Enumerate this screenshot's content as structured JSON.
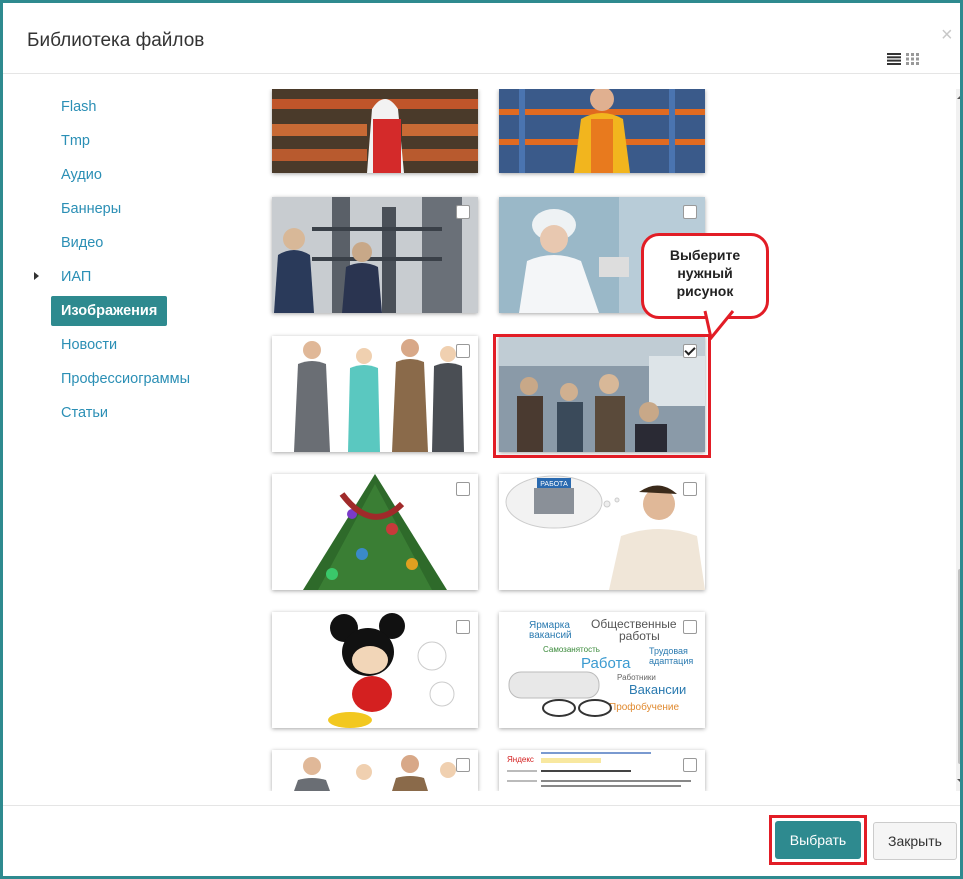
{
  "dialog": {
    "title": "Библиотека файлов",
    "close_symbol": "×"
  },
  "sidebar": {
    "items": [
      {
        "label": "Flash"
      },
      {
        "label": "Tmp"
      },
      {
        "label": "Аудио"
      },
      {
        "label": "Баннеры"
      },
      {
        "label": "Видео"
      },
      {
        "label": "ИАП",
        "expandable": true
      },
      {
        "label": "Изображения",
        "active": true
      },
      {
        "label": "Новости"
      },
      {
        "label": "Профессиограммы"
      },
      {
        "label": "Статьи"
      }
    ]
  },
  "gallery": {
    "thumbnails": [
      {
        "subject": "bakery-worker",
        "checked": false
      },
      {
        "subject": "warehouse-worker",
        "checked": false
      },
      {
        "subject": "industrial-workers",
        "checked": false
      },
      {
        "subject": "lab-worker",
        "checked": false
      },
      {
        "subject": "professionals-group",
        "checked": false
      },
      {
        "subject": "job-center-crowd",
        "checked": true
      },
      {
        "subject": "christmas-tree",
        "checked": false
      },
      {
        "subject": "thinking-man",
        "checked": false
      },
      {
        "subject": "cartoon-mouse",
        "checked": false
      },
      {
        "subject": "word-cloud",
        "checked": false
      },
      {
        "subject": "professionals-group-2",
        "checked": false
      },
      {
        "subject": "search-results-screenshot",
        "checked": false
      }
    ],
    "thumb_text": {
      "maze_sign": "РАБОТА",
      "wordcloud": [
        "Ярмарка",
        "вакансий",
        "Общественные",
        "работы",
        "Самозанятость",
        "Трудовая",
        "адаптация",
        "Работа",
        "Работники",
        "Вакансии",
        "Профобучение"
      ],
      "search_logo": "Яндекс"
    }
  },
  "callout": {
    "lines": [
      "Выберите",
      "нужный",
      "рисунок"
    ]
  },
  "footer": {
    "select_label": "Выбрать",
    "close_label": "Закрыть"
  },
  "colors": {
    "accent": "#2e8a8f",
    "link": "#2b8fb5",
    "highlight": "#e21d26"
  },
  "icons": {
    "list_view": "list-view-icon",
    "grid_view": "grid-view-icon",
    "close": "close-icon"
  }
}
